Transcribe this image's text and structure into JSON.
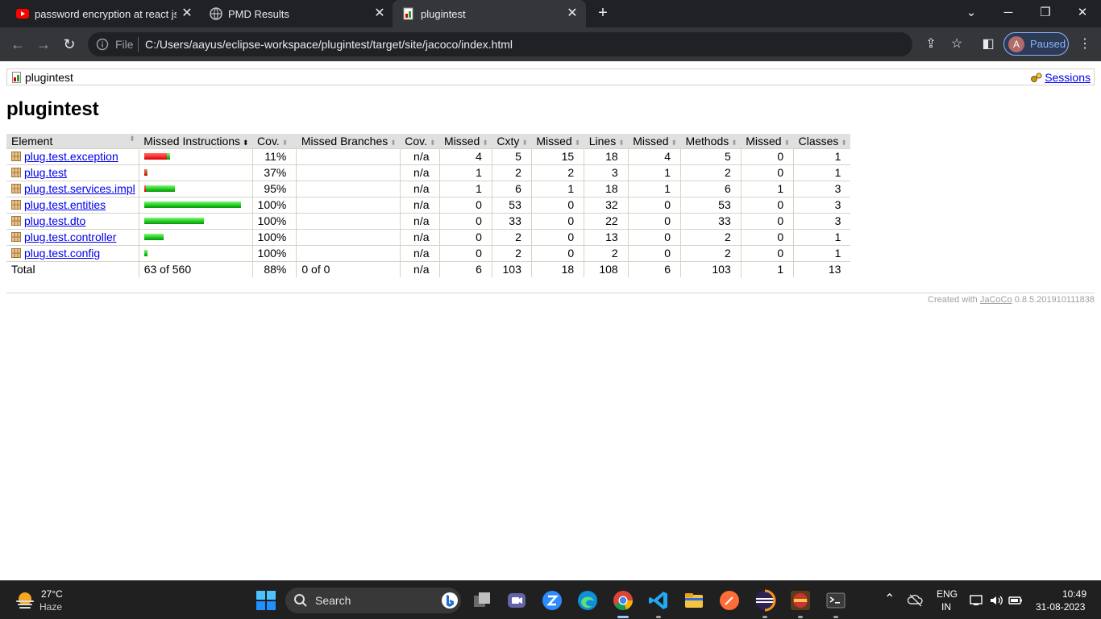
{
  "browser": {
    "tabs": [
      {
        "title": "password encryption at react js -",
        "icon": "youtube-icon"
      },
      {
        "title": "PMD Results",
        "icon": "globe-icon"
      },
      {
        "title": "plugintest",
        "icon": "report-icon",
        "active": true
      }
    ],
    "omnibox": {
      "scheme_label": "File",
      "url": "C:/Users/aayus/eclipse-workspace/plugintest/target/site/jacoco/index.html"
    },
    "profile": {
      "initial": "A",
      "status": "Paused"
    }
  },
  "page": {
    "breadcrumb": "plugintest",
    "sessions_link": "Sessions",
    "title": "plugintest",
    "table": {
      "headers": [
        "Element",
        "Missed Instructions",
        "Cov.",
        "Missed Branches",
        "Cov.",
        "Missed",
        "Cxty",
        "Missed",
        "Lines",
        "Missed",
        "Methods",
        "Missed",
        "Classes"
      ],
      "rows": [
        {
          "element": "plug.test.exception",
          "coverage": "11%",
          "cov_fraction": 0.11,
          "bar_scale": 0.27,
          "branch_cov": "n/a",
          "missed_cxty": "4",
          "cxty": "5",
          "missed_lines": "15",
          "lines": "18",
          "missed_methods": "4",
          "methods": "5",
          "missed_classes": "0",
          "classes": "1"
        },
        {
          "element": "plug.test",
          "coverage": "37%",
          "cov_fraction": 0.37,
          "bar_scale": 0.03,
          "branch_cov": "n/a",
          "missed_cxty": "1",
          "cxty": "2",
          "missed_lines": "2",
          "lines": "3",
          "missed_methods": "1",
          "methods": "2",
          "missed_classes": "0",
          "classes": "1"
        },
        {
          "element": "plug.test.services.impl",
          "coverage": "95%",
          "cov_fraction": 0.95,
          "bar_scale": 0.32,
          "branch_cov": "n/a",
          "missed_cxty": "1",
          "cxty": "6",
          "missed_lines": "1",
          "lines": "18",
          "missed_methods": "1",
          "methods": "6",
          "missed_classes": "1",
          "classes": "3"
        },
        {
          "element": "plug.test.entities",
          "coverage": "100%",
          "cov_fraction": 1.0,
          "bar_scale": 1.0,
          "branch_cov": "n/a",
          "missed_cxty": "0",
          "cxty": "53",
          "missed_lines": "0",
          "lines": "32",
          "missed_methods": "0",
          "methods": "53",
          "missed_classes": "0",
          "classes": "3"
        },
        {
          "element": "plug.test.dto",
          "coverage": "100%",
          "cov_fraction": 1.0,
          "bar_scale": 0.62,
          "branch_cov": "n/a",
          "missed_cxty": "0",
          "cxty": "33",
          "missed_lines": "0",
          "lines": "22",
          "missed_methods": "0",
          "methods": "33",
          "missed_classes": "0",
          "classes": "3"
        },
        {
          "element": "plug.test.controller",
          "coverage": "100%",
          "cov_fraction": 1.0,
          "bar_scale": 0.2,
          "branch_cov": "n/a",
          "missed_cxty": "0",
          "cxty": "2",
          "missed_lines": "0",
          "lines": "13",
          "missed_methods": "0",
          "methods": "2",
          "missed_classes": "0",
          "classes": "1"
        },
        {
          "element": "plug.test.config",
          "coverage": "100%",
          "cov_fraction": 1.0,
          "bar_scale": 0.03,
          "branch_cov": "n/a",
          "missed_cxty": "0",
          "cxty": "2",
          "missed_lines": "0",
          "lines": "2",
          "missed_methods": "0",
          "methods": "2",
          "missed_classes": "0",
          "classes": "1"
        }
      ],
      "total": {
        "label": "Total",
        "missed_instructions": "63 of 560",
        "coverage": "88%",
        "missed_branches": "0 of 0",
        "branch_cov": "n/a",
        "missed_cxty": "6",
        "cxty": "103",
        "missed_lines": "18",
        "lines": "108",
        "missed_methods": "6",
        "methods": "103",
        "missed_classes": "1",
        "classes": "13"
      }
    },
    "footer": {
      "prefix": "Created with",
      "link": "JaCoCo",
      "version": "0.8.5.201910111838"
    }
  },
  "taskbar": {
    "weather": {
      "temp": "27°C",
      "condition": "Haze"
    },
    "search_label": "Search",
    "tray": {
      "lang_top": "ENG",
      "lang_bottom": "IN",
      "time": "10:49",
      "date": "31-08-2023"
    }
  },
  "colors": {
    "covered": "#33cc33",
    "missed": "#ff3333",
    "header_bg": "#e0e0e0",
    "chrome_bg": "#202124"
  }
}
